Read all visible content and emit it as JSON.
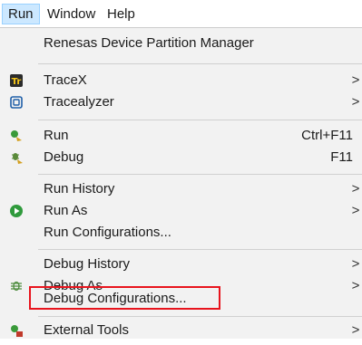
{
  "menubar": {
    "items": [
      {
        "label": "Run"
      },
      {
        "label": "Window"
      },
      {
        "label": "Help"
      }
    ]
  },
  "menu": {
    "items": [
      {
        "label": "Renesas Device Partition Manager",
        "shortcut": "",
        "submenu": false,
        "icon": "none"
      },
      {
        "label": "TraceX",
        "shortcut": "",
        "submenu": true,
        "icon": "tracex-icon"
      },
      {
        "label": "Tracealyzer",
        "shortcut": "",
        "submenu": true,
        "icon": "tracealyzer-icon"
      },
      {
        "label": "Run",
        "shortcut": "Ctrl+F11",
        "submenu": false,
        "icon": "run-icon"
      },
      {
        "label": "Debug",
        "shortcut": "F11",
        "submenu": false,
        "icon": "debug-icon"
      },
      {
        "label": "Run History",
        "shortcut": "",
        "submenu": true,
        "icon": "none"
      },
      {
        "label": "Run As",
        "shortcut": "",
        "submenu": true,
        "icon": "run-as-icon"
      },
      {
        "label": "Run Configurations...",
        "shortcut": "",
        "submenu": false,
        "icon": "none"
      },
      {
        "label": "Debug History",
        "shortcut": "",
        "submenu": true,
        "icon": "none"
      },
      {
        "label": "Debug As",
        "shortcut": "",
        "submenu": true,
        "icon": "debug-as-icon"
      },
      {
        "label": "Debug Configurations...",
        "shortcut": "",
        "submenu": false,
        "icon": "none"
      },
      {
        "label": "External Tools",
        "shortcut": "",
        "submenu": true,
        "icon": "external-tools-icon"
      }
    ],
    "submenu_arrow": ">"
  },
  "colors": {
    "highlight_border": "#e8141d",
    "menu_bg": "#f2f2f2",
    "active_menubar_bg": "#cce8ff"
  }
}
